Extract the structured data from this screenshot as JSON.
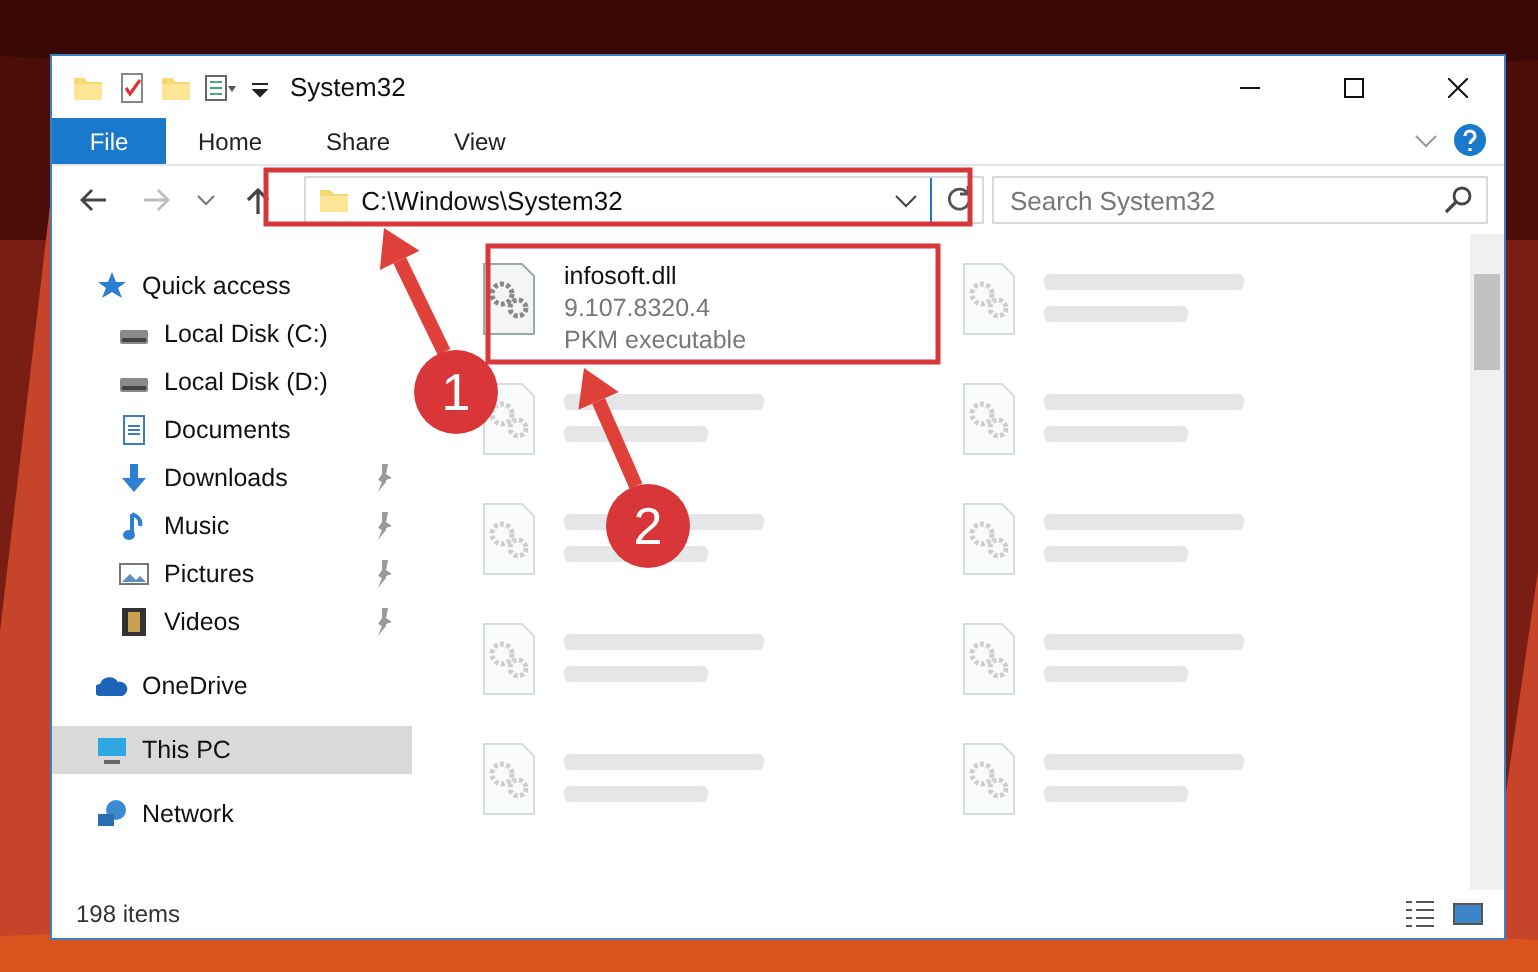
{
  "window": {
    "title": "System32"
  },
  "ribbon_tabs": [
    {
      "label": "File",
      "kind": "menu"
    },
    {
      "label": "Home",
      "kind": "tab"
    },
    {
      "label": "Share",
      "kind": "tab"
    },
    {
      "label": "View",
      "kind": "tab"
    }
  ],
  "address": {
    "path": "C:\\Windows\\System32",
    "highlighted": true
  },
  "search": {
    "placeholder": "Search System32"
  },
  "sidebar": {
    "items": [
      {
        "label": "Quick access",
        "kind": "star",
        "selected": false,
        "children": [
          {
            "label": "Local Disk (C:)",
            "kind": "disk",
            "selected": false,
            "pinned": false
          },
          {
            "label": "Local Disk (D:)",
            "kind": "disk",
            "selected": false,
            "pinned": false
          },
          {
            "label": "Documents",
            "kind": "documents",
            "selected": false,
            "pinned": false
          },
          {
            "label": "Downloads",
            "kind": "downloads",
            "selected": false,
            "pinned": true
          },
          {
            "label": "Music",
            "kind": "music",
            "selected": false,
            "pinned": true
          },
          {
            "label": "Pictures",
            "kind": "pictures",
            "selected": false,
            "pinned": true
          },
          {
            "label": "Videos",
            "kind": "videos",
            "selected": false,
            "pinned": true
          }
        ]
      },
      {
        "label": "OneDrive",
        "kind": "cloud",
        "selected": false
      },
      {
        "label": "This PC",
        "kind": "pc",
        "selected": true
      },
      {
        "label": "Network",
        "kind": "network",
        "selected": false
      }
    ]
  },
  "files": [
    {
      "name": "infosoft.dll",
      "version": "9.107.8320.4",
      "type": "PKM executable",
      "blurred": false,
      "highlighted": true
    },
    {
      "blurred": true,
      "highlighted": false
    },
    {
      "blurred": true,
      "highlighted": false
    },
    {
      "blurred": true,
      "highlighted": false
    },
    {
      "blurred": true,
      "highlighted": false
    },
    {
      "blurred": true,
      "highlighted": false
    },
    {
      "blurred": true,
      "highlighted": false
    },
    {
      "blurred": true,
      "highlighted": false
    },
    {
      "blurred": true,
      "highlighted": false
    },
    {
      "blurred": true,
      "highlighted": false
    }
  ],
  "status_bar": {
    "count": "198 items"
  },
  "callouts": [
    {
      "number": "1"
    },
    {
      "number": "2"
    }
  ]
}
